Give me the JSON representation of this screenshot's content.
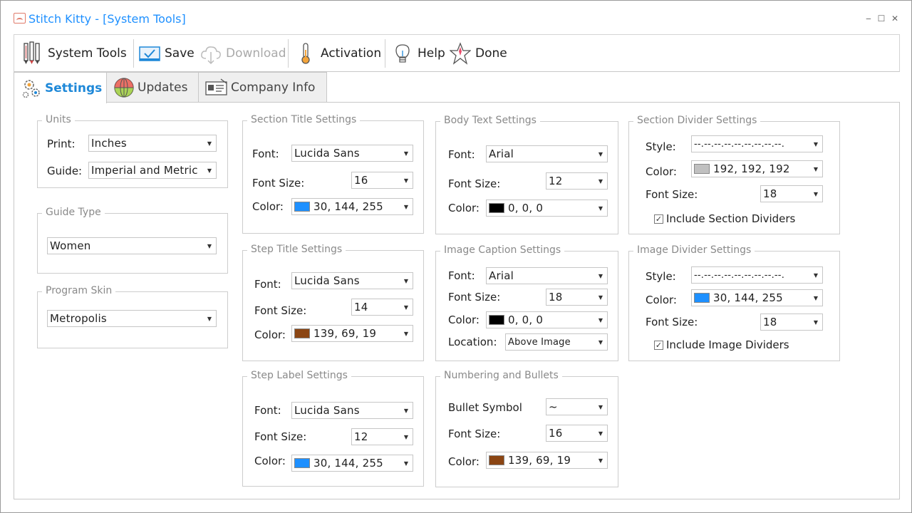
{
  "window": {
    "title": "Stitch Kitty - [System Tools]",
    "controls": {
      "minimize": "‒",
      "maximize": "☐",
      "close": "✕"
    }
  },
  "toolbar": {
    "system_tools": "System Tools",
    "save": "Save",
    "download": "Download",
    "activation": "Activation",
    "help": "Help",
    "done": "Done"
  },
  "tabs": {
    "settings": "Settings",
    "updates": "Updates",
    "company_info": "Company Info"
  },
  "units": {
    "legend": "Units",
    "print_label": "Print:",
    "print_value": "Inches",
    "guide_label": "Guide:",
    "guide_value": "Imperial and Metric"
  },
  "guide_type": {
    "legend": "Guide Type",
    "value": "Women"
  },
  "program_skin": {
    "legend": "Program Skin",
    "value": "Metropolis"
  },
  "section_title": {
    "legend": "Section Title Settings",
    "font_label": "Font:",
    "font": "Lucida Sans",
    "size_label": "Font Size:",
    "size": "16",
    "color_label": "Color:",
    "color": "30, 144, 255",
    "color_hex": "#1e90ff"
  },
  "step_title": {
    "legend": "Step Title Settings",
    "font_label": "Font:",
    "font": "Lucida Sans",
    "size_label": "Font Size:",
    "size": "14",
    "color_label": "Color:",
    "color": "139, 69, 19",
    "color_hex": "#8b4513"
  },
  "step_label": {
    "legend": "Step Label Settings",
    "font_label": "Font:",
    "font": "Lucida Sans",
    "size_label": "Font Size:",
    "size": "12",
    "color_label": "Color:",
    "color": "30, 144, 255",
    "color_hex": "#1e90ff"
  },
  "body_text": {
    "legend": "Body Text Settings",
    "font_label": "Font:",
    "font": "Arial",
    "size_label": "Font Size:",
    "size": "12",
    "color_label": "Color:",
    "color": "0, 0, 0",
    "color_hex": "#000000"
  },
  "image_caption": {
    "legend": "Image Caption Settings",
    "font_label": "Font:",
    "font": "Arial",
    "size_label": "Font Size:",
    "size": "18",
    "color_label": "Color:",
    "color": "0, 0, 0",
    "color_hex": "#000000",
    "location_label": "Location:",
    "location": "Above Image"
  },
  "numbering": {
    "legend": "Numbering and Bullets",
    "bullet_label": "Bullet Symbol",
    "bullet": "~",
    "size_label": "Font Size:",
    "size": "16",
    "color_label": "Color:",
    "color": "139, 69, 19",
    "color_hex": "#8b4513"
  },
  "section_divider": {
    "legend": "Section Divider Settings",
    "style_label": "Style:",
    "style": "--.--.--.--.--.--.--.--.--.",
    "color_label": "Color:",
    "color": "192, 192, 192",
    "color_hex": "#c0c0c0",
    "size_label": "Font Size:",
    "size": "18",
    "include_label": "Include Section Dividers",
    "include_checked": true
  },
  "image_divider": {
    "legend": "Image Divider Settings",
    "style_label": "Style:",
    "style": "--.--.--.--.--.--.--.--.--.",
    "color_label": "Color:",
    "color": "30, 144, 255",
    "color_hex": "#1e90ff",
    "size_label": "Font Size:",
    "size": "18",
    "include_label": "Include Image Dividers",
    "include_checked": true
  },
  "icons": {
    "app": "stitch-kitty-app-icon",
    "system_tools": "pencils-icon",
    "save": "monitor-check-icon",
    "download": "cloud-download-icon",
    "activation": "thermometer-icon",
    "help": "lightbulb-icon",
    "done": "star-icon",
    "settings": "gears-icon",
    "updates": "globe-icon",
    "company_info": "id-card-icon",
    "dropdown": "chevron-down-icon"
  },
  "colors": {
    "accent": "#1e88d8",
    "title": "#1e90ff"
  }
}
